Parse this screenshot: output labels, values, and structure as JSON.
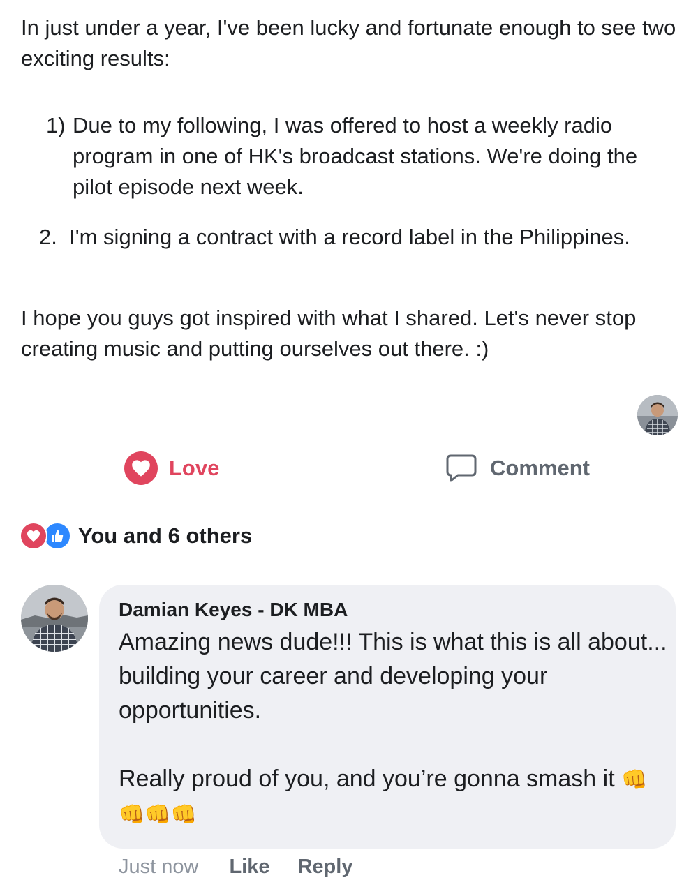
{
  "post": {
    "intro": "In just under a year, I've been lucky and fortunate enough to see two exciting results:",
    "item1_marker": "1)",
    "item1_text": "Due to my following, I was offered to host a weekly radio program in one of HK's broadcast stations. We're doing the pilot episode next week.",
    "item2_marker": "2.",
    "item2_text": "I'm signing a contract with a record label in the Philippines.",
    "closing": "I hope you guys got inspired with what I shared. Let's never stop creating music and putting ourselves out there. :)"
  },
  "actions": {
    "love_label": "Love",
    "comment_label": "Comment"
  },
  "reactions": {
    "summary": "You and 6 others"
  },
  "comment": {
    "author": "Damian Keyes - DK MBA",
    "paragraph1": "Amazing news dude!!! This is what this is all about... building your career and developing your opportunities.",
    "paragraph2": "Really proud of you, and you’re gonna smash it",
    "emoji": "👊👊👊👊",
    "timestamp": "Just now",
    "like_label": "Like",
    "reply_label": "Reply"
  },
  "colors": {
    "love": "#e0455e",
    "like_blue": "#2d88ff",
    "bubble_bg": "#eff0f4",
    "muted": "#8d949e"
  }
}
